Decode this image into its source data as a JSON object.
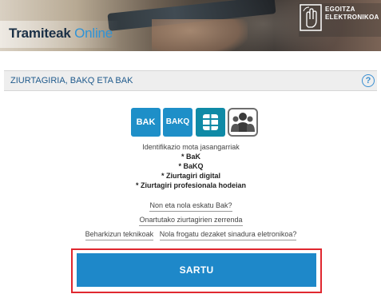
{
  "banner": {
    "brand_part1": "Tramiteak",
    "brand_part2": "Online",
    "egoitza_line1": "EGOITZA",
    "egoitza_line2": "ELEKTRONIKOA"
  },
  "section": {
    "title": "ZIURTAGIRIA, BAKQ ETA BAK",
    "help_icon_glyph": "?"
  },
  "id_methods": {
    "icons": [
      {
        "name": "bak-icon",
        "label": "BAK"
      },
      {
        "name": "bakq-icon",
        "label": "BAKQ"
      },
      {
        "name": "chip-card-icon",
        "label": ""
      },
      {
        "name": "professional-group-icon",
        "label": ""
      }
    ]
  },
  "info": {
    "heading": "Identifikazio mota jasangarriak",
    "items": [
      "* BaK",
      "* BaKQ",
      "* Ziurtagiri digital",
      "* Ziurtagiri profesionala hodeian"
    ]
  },
  "links": {
    "how_to_get_bak": "Non eta nola eskatu Bak?",
    "accepted_certs": "Onartutako ziurtagirien zerrenda",
    "tech_requirements": "Beharkizun teknikoak",
    "verify_signature": "Nola frogatu dezaket sinadura eletronikoa?"
  },
  "button": {
    "label": "SARTU"
  },
  "colors": {
    "accent_blue": "#1e88c9",
    "highlight_red": "#e0272f",
    "section_title": "#1f5a8c"
  }
}
